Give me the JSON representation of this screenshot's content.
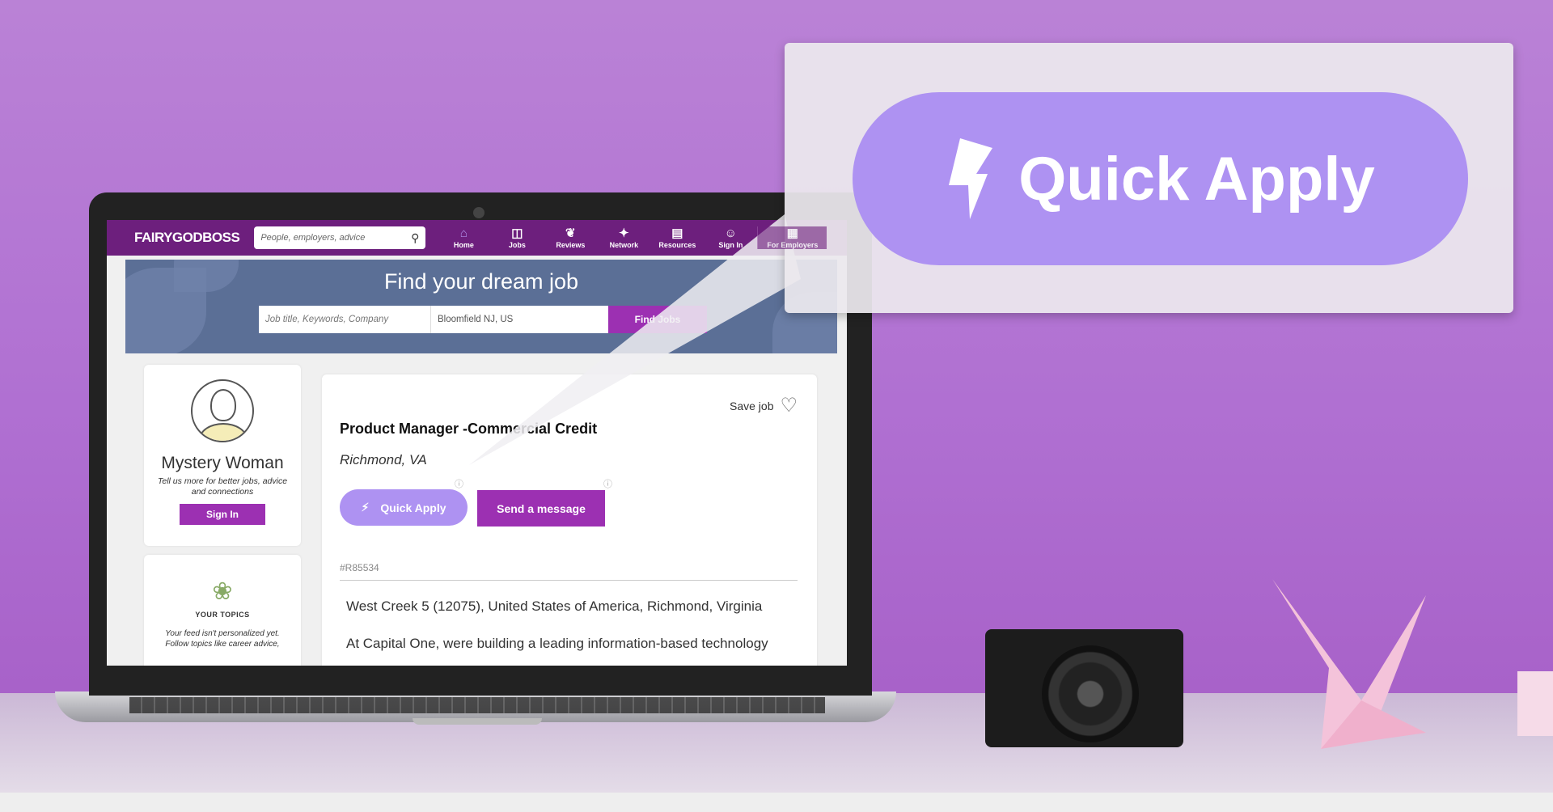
{
  "nav": {
    "logo": "FAIRYGODBOSS",
    "search_placeholder": "People, employers, advice",
    "items": [
      {
        "label": "Home",
        "icon": "home-icon"
      },
      {
        "label": "Jobs",
        "icon": "briefcase-icon"
      },
      {
        "label": "Reviews",
        "icon": "leaf-icon"
      },
      {
        "label": "Network",
        "icon": "network-icon"
      },
      {
        "label": "Resources",
        "icon": "book-icon"
      },
      {
        "label": "Sign In",
        "icon": "user-icon"
      },
      {
        "label": "For Employers",
        "icon": "building-icon"
      }
    ]
  },
  "hero": {
    "title": "Find your dream job",
    "keyword_placeholder": "Job title, Keywords, Company",
    "location_value": "Bloomfield NJ, US",
    "find_label": "Find Jobs"
  },
  "profile": {
    "name": "Mystery Woman",
    "tagline": "Tell us more for better jobs, advice and connections",
    "sign_in": "Sign In"
  },
  "topics": {
    "title": "YOUR TOPICS",
    "text": "Your feed isn't personalized yet. Follow topics like career advice,"
  },
  "job": {
    "save_label": "Save job",
    "title": "Product Manager -Commercial Credit",
    "location": "Richmond, VA",
    "quick_apply": "Quick Apply",
    "send_message": "Send a message",
    "id": "#R85534",
    "address": "West Creek 5 (12075), United States of America, Richmond, Virginia",
    "body": "At Capital One, were building a leading information-based technology"
  },
  "callout": {
    "label": "Quick Apply",
    "icon": "lightning-icon"
  },
  "colors": {
    "brand": "#6d1f7d",
    "accent": "#9c30b2",
    "quick_apply": "#ae92f2",
    "hero": "#5b6f96"
  }
}
